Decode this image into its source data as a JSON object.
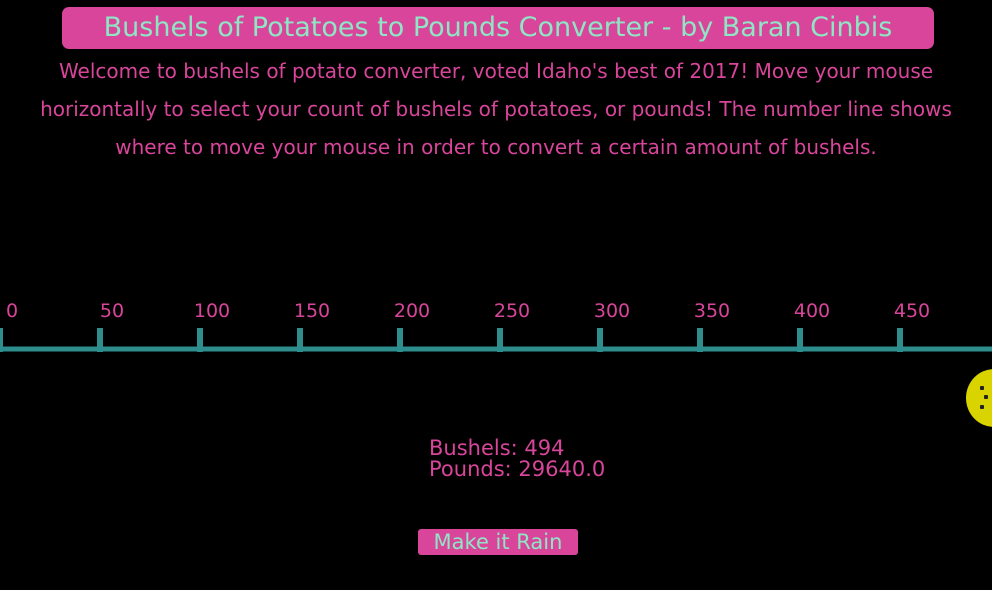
{
  "header": {
    "title": "Bushels of Potatoes to Pounds Converter - by Baran Cinbis"
  },
  "intro": {
    "text": "Welcome to bushels of potato converter, voted Idaho's best of 2017!  Move your mouse horizontally to select your count of bushels of potatoes, or pounds!  The number line shows where to move your mouse in order to convert a certain amount of bushels."
  },
  "number_line": {
    "ticks": [
      "0",
      "50",
      "100",
      "150",
      "200",
      "250",
      "300",
      "350",
      "400",
      "450"
    ],
    "line_color": "#2e8d8d",
    "label_color": "#d8459a"
  },
  "readout": {
    "bushels": "Bushels: 494",
    "pounds": "Pounds: 29640.0"
  },
  "button": {
    "label": "Make it Rain"
  },
  "potato": {
    "icon": "potato-icon",
    "color": "#d9d400"
  },
  "colors": {
    "background": "#000000",
    "accent": "#d8459a",
    "mint": "#8fe6c4",
    "teal": "#2e8d8d"
  }
}
